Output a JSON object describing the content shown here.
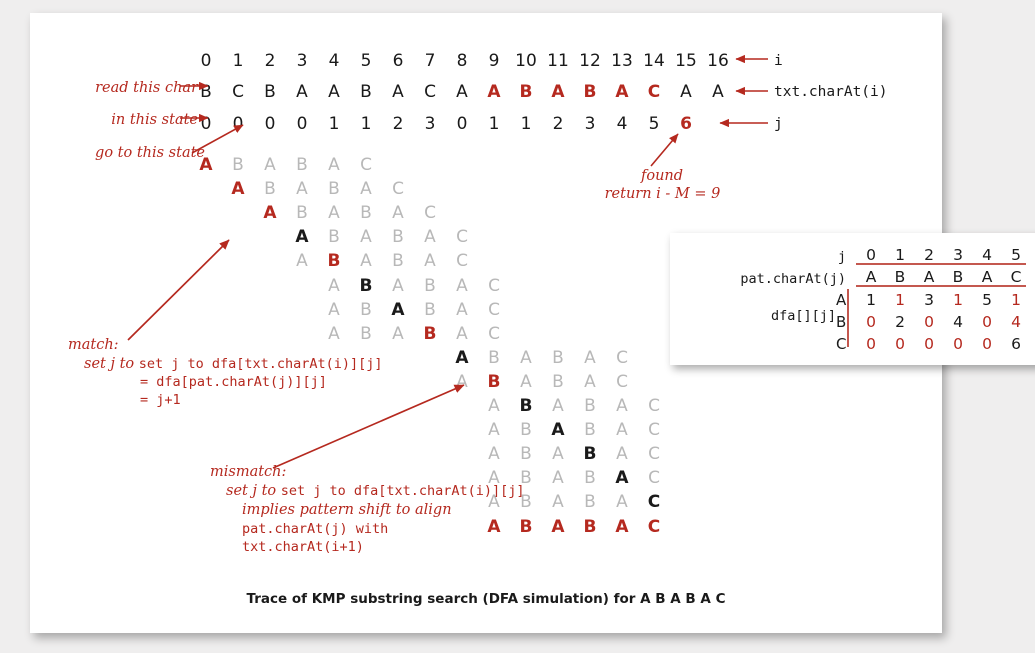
{
  "caption": "Trace of KMP substring search (DFA simulation) for A  B  A  B  A  C",
  "colors": {
    "red": "#b5291f",
    "black": "#1a1a1a",
    "gray": "#b8b8b8",
    "page_bg": "#efeeee",
    "canvas_bg": "#ffffff",
    "rule": "#c4584f"
  },
  "annotations": {
    "read_this_char": "read this char",
    "in_this_state": "in this state",
    "go_to_this_state": "go to this state",
    "found": "found",
    "return_line": "return i - M = 9",
    "match_title": "match:",
    "match_l1": "set j to dfa[txt.charAt(i)][j]",
    "match_l2": "= dfa[pat.charAt(j)][j]",
    "match_l3": "= j+1",
    "mismatch_title": "mismatch:",
    "mismatch_l1": "set j to dfa[txt.charAt(i)][j]",
    "mismatch_l2": "implies pattern shift to align",
    "mismatch_l3": "pat.charAt(j) with",
    "mismatch_l4": "txt.charAt(i+1)"
  },
  "right_labels": {
    "i": "i",
    "txt": "txt.charAt(i)",
    "j": "j"
  },
  "header": {
    "indices": [
      "0",
      "1",
      "2",
      "3",
      "4",
      "5",
      "6",
      "7",
      "8",
      "9",
      "10",
      "11",
      "12",
      "13",
      "14",
      "15",
      "16"
    ],
    "text_chars": [
      {
        "c": "B",
        "color": "black"
      },
      {
        "c": "C",
        "color": "black"
      },
      {
        "c": "B",
        "color": "black"
      },
      {
        "c": "A",
        "color": "black"
      },
      {
        "c": "A",
        "color": "black"
      },
      {
        "c": "B",
        "color": "black"
      },
      {
        "c": "A",
        "color": "black"
      },
      {
        "c": "C",
        "color": "black"
      },
      {
        "c": "A",
        "color": "black"
      },
      {
        "c": "A",
        "color": "red"
      },
      {
        "c": "B",
        "color": "red"
      },
      {
        "c": "A",
        "color": "red"
      },
      {
        "c": "B",
        "color": "red"
      },
      {
        "c": "A",
        "color": "red"
      },
      {
        "c": "C",
        "color": "red"
      },
      {
        "c": "A",
        "color": "black"
      },
      {
        "c": "A",
        "color": "black"
      }
    ],
    "states": [
      {
        "c": "0",
        "color": "black"
      },
      {
        "c": "0",
        "color": "black"
      },
      {
        "c": "0",
        "color": "black"
      },
      {
        "c": "0",
        "color": "black"
      },
      {
        "c": "1",
        "color": "black"
      },
      {
        "c": "1",
        "color": "black"
      },
      {
        "c": "2",
        "color": "black"
      },
      {
        "c": "3",
        "color": "black"
      },
      {
        "c": "0",
        "color": "black"
      },
      {
        "c": "1",
        "color": "black"
      },
      {
        "c": "1",
        "color": "black"
      },
      {
        "c": "2",
        "color": "black"
      },
      {
        "c": "3",
        "color": "black"
      },
      {
        "c": "4",
        "color": "black"
      },
      {
        "c": "5",
        "color": "black"
      },
      {
        "c": "6",
        "color": "red"
      }
    ]
  },
  "trace_rows": [
    {
      "offset": 0,
      "chars": [
        {
          "c": "A",
          "color": "red"
        },
        {
          "c": "B",
          "color": "gray"
        },
        {
          "c": "A",
          "color": "gray"
        },
        {
          "c": "B",
          "color": "gray"
        },
        {
          "c": "A",
          "color": "gray"
        },
        {
          "c": "C",
          "color": "gray"
        }
      ]
    },
    {
      "offset": 1,
      "chars": [
        {
          "c": "A",
          "color": "red"
        },
        {
          "c": "B",
          "color": "gray"
        },
        {
          "c": "A",
          "color": "gray"
        },
        {
          "c": "B",
          "color": "gray"
        },
        {
          "c": "A",
          "color": "gray"
        },
        {
          "c": "C",
          "color": "gray"
        }
      ]
    },
    {
      "offset": 2,
      "chars": [
        {
          "c": "A",
          "color": "red"
        },
        {
          "c": "B",
          "color": "gray"
        },
        {
          "c": "A",
          "color": "gray"
        },
        {
          "c": "B",
          "color": "gray"
        },
        {
          "c": "A",
          "color": "gray"
        },
        {
          "c": "C",
          "color": "gray"
        }
      ]
    },
    {
      "offset": 3,
      "chars": [
        {
          "c": "A",
          "color": "black"
        },
        {
          "c": "B",
          "color": "gray"
        },
        {
          "c": "A",
          "color": "gray"
        },
        {
          "c": "B",
          "color": "gray"
        },
        {
          "c": "A",
          "color": "gray"
        },
        {
          "c": "C",
          "color": "gray"
        }
      ]
    },
    {
      "offset": 3,
      "chars": [
        {
          "c": "A",
          "color": "gray"
        },
        {
          "c": "B",
          "color": "red"
        },
        {
          "c": "A",
          "color": "gray"
        },
        {
          "c": "B",
          "color": "gray"
        },
        {
          "c": "A",
          "color": "gray"
        },
        {
          "c": "C",
          "color": "gray"
        }
      ]
    },
    {
      "offset": 4,
      "chars": [
        {
          "c": "A",
          "color": "gray"
        },
        {
          "c": "B",
          "color": "black"
        },
        {
          "c": "A",
          "color": "gray"
        },
        {
          "c": "B",
          "color": "gray"
        },
        {
          "c": "A",
          "color": "gray"
        },
        {
          "c": "C",
          "color": "gray"
        }
      ]
    },
    {
      "offset": 4,
      "chars": [
        {
          "c": "A",
          "color": "gray"
        },
        {
          "c": "B",
          "color": "gray"
        },
        {
          "c": "A",
          "color": "black"
        },
        {
          "c": "B",
          "color": "gray"
        },
        {
          "c": "A",
          "color": "gray"
        },
        {
          "c": "C",
          "color": "gray"
        }
      ]
    },
    {
      "offset": 4,
      "chars": [
        {
          "c": "A",
          "color": "gray"
        },
        {
          "c": "B",
          "color": "gray"
        },
        {
          "c": "A",
          "color": "gray"
        },
        {
          "c": "B",
          "color": "red"
        },
        {
          "c": "A",
          "color": "gray"
        },
        {
          "c": "C",
          "color": "gray"
        }
      ]
    },
    {
      "offset": 8,
      "chars": [
        {
          "c": "A",
          "color": "black"
        },
        {
          "c": "B",
          "color": "gray"
        },
        {
          "c": "A",
          "color": "gray"
        },
        {
          "c": "B",
          "color": "gray"
        },
        {
          "c": "A",
          "color": "gray"
        },
        {
          "c": "C",
          "color": "gray"
        }
      ]
    },
    {
      "offset": 8,
      "chars": [
        {
          "c": "A",
          "color": "gray"
        },
        {
          "c": "B",
          "color": "red"
        },
        {
          "c": "A",
          "color": "gray"
        },
        {
          "c": "B",
          "color": "gray"
        },
        {
          "c": "A",
          "color": "gray"
        },
        {
          "c": "C",
          "color": "gray"
        }
      ]
    },
    {
      "offset": 9,
      "chars": [
        {
          "c": "A",
          "color": "gray"
        },
        {
          "c": "B",
          "color": "black"
        },
        {
          "c": "A",
          "color": "gray"
        },
        {
          "c": "B",
          "color": "gray"
        },
        {
          "c": "A",
          "color": "gray"
        },
        {
          "c": "C",
          "color": "gray"
        }
      ]
    },
    {
      "offset": 9,
      "chars": [
        {
          "c": "A",
          "color": "gray"
        },
        {
          "c": "B",
          "color": "gray"
        },
        {
          "c": "A",
          "color": "black"
        },
        {
          "c": "B",
          "color": "gray"
        },
        {
          "c": "A",
          "color": "gray"
        },
        {
          "c": "C",
          "color": "gray"
        }
      ]
    },
    {
      "offset": 9,
      "chars": [
        {
          "c": "A",
          "color": "gray"
        },
        {
          "c": "B",
          "color": "gray"
        },
        {
          "c": "A",
          "color": "gray"
        },
        {
          "c": "B",
          "color": "black"
        },
        {
          "c": "A",
          "color": "gray"
        },
        {
          "c": "C",
          "color": "gray"
        }
      ]
    },
    {
      "offset": 9,
      "chars": [
        {
          "c": "A",
          "color": "gray"
        },
        {
          "c": "B",
          "color": "gray"
        },
        {
          "c": "A",
          "color": "gray"
        },
        {
          "c": "B",
          "color": "gray"
        },
        {
          "c": "A",
          "color": "black"
        },
        {
          "c": "C",
          "color": "gray"
        }
      ]
    },
    {
      "offset": 9,
      "chars": [
        {
          "c": "A",
          "color": "gray"
        },
        {
          "c": "B",
          "color": "gray"
        },
        {
          "c": "A",
          "color": "gray"
        },
        {
          "c": "B",
          "color": "gray"
        },
        {
          "c": "A",
          "color": "gray"
        },
        {
          "c": "C",
          "color": "black"
        }
      ]
    },
    {
      "offset": 9,
      "chars": [
        {
          "c": "A",
          "color": "red"
        },
        {
          "c": "B",
          "color": "red"
        },
        {
          "c": "A",
          "color": "red"
        },
        {
          "c": "B",
          "color": "red"
        },
        {
          "c": "A",
          "color": "red"
        },
        {
          "c": "C",
          "color": "red"
        }
      ]
    }
  ],
  "dfa_table": {
    "row_label_j": "j",
    "row_label_pat": "pat.charAt(j)",
    "row_label_dfa": "dfa[][j]",
    "j_values": [
      "0",
      "1",
      "2",
      "3",
      "4",
      "5"
    ],
    "pattern": [
      "A",
      "B",
      "A",
      "B",
      "A",
      "C"
    ],
    "alphabet": [
      "A",
      "B",
      "C"
    ],
    "rows": [
      {
        "letter": "A",
        "values": [
          {
            "v": "1",
            "color": "black"
          },
          {
            "v": "1",
            "color": "red"
          },
          {
            "v": "3",
            "color": "black"
          },
          {
            "v": "1",
            "color": "red"
          },
          {
            "v": "5",
            "color": "black"
          },
          {
            "v": "1",
            "color": "red"
          }
        ]
      },
      {
        "letter": "B",
        "values": [
          {
            "v": "0",
            "color": "red"
          },
          {
            "v": "2",
            "color": "black"
          },
          {
            "v": "0",
            "color": "red"
          },
          {
            "v": "4",
            "color": "black"
          },
          {
            "v": "0",
            "color": "red"
          },
          {
            "v": "4",
            "color": "red"
          }
        ]
      },
      {
        "letter": "C",
        "values": [
          {
            "v": "0",
            "color": "red"
          },
          {
            "v": "0",
            "color": "red"
          },
          {
            "v": "0",
            "color": "red"
          },
          {
            "v": "0",
            "color": "red"
          },
          {
            "v": "0",
            "color": "red"
          },
          {
            "v": "6",
            "color": "black"
          }
        ]
      }
    ]
  }
}
